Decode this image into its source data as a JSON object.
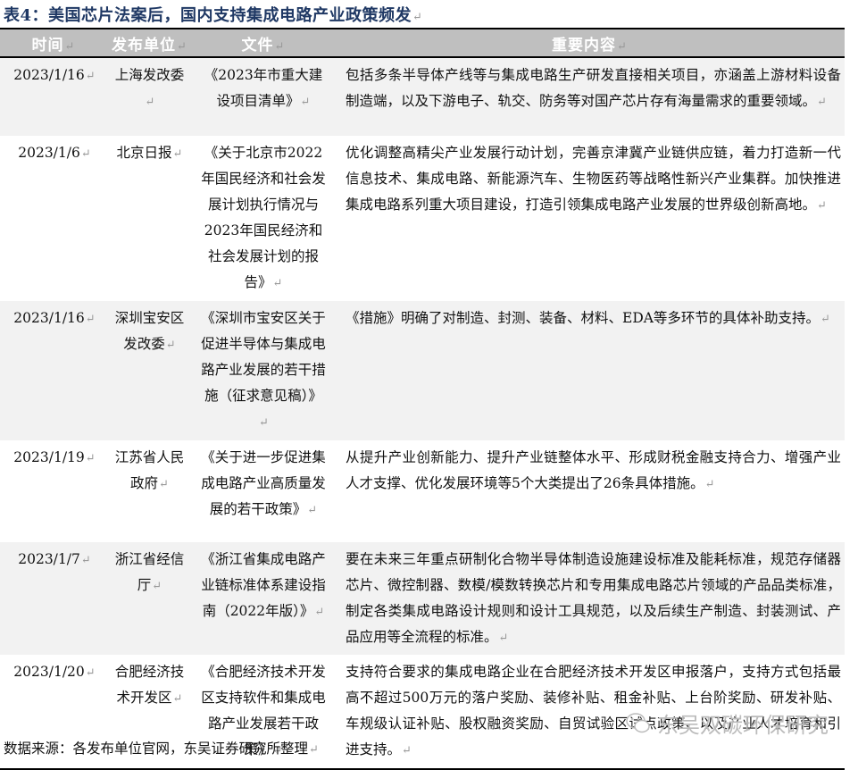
{
  "title": "表4：美国芯片法案后，国内支持集成电路产业政策频发",
  "headers": [
    "时间",
    "发布单位",
    "文件",
    "重要内容"
  ],
  "rows": [
    {
      "time": "2023/1/16",
      "unit": "上海发改委",
      "doc": "《2023年市重大建设项目清单》",
      "content": "包括多条半导体产线等与集成电路生产研发直接相关项目，亦涵盖上游材料设备制造端，以及下游电子、轨交、防务等对国产芯片存有海量需求的重要领域。"
    },
    {
      "time": "2023/1/6",
      "unit": "北京日报",
      "doc": "《关于北京市2022年国民经济和社会发展计划执行情况与2023年国民经济和社会发展计划的报告》",
      "content": "优化调整高精尖产业发展行动计划，完善京津冀产业链供应链，着力打造新一代信息技术、集成电路、新能源汽车、生物医药等战略性新兴产业集群。加快推进集成电路系列重大项目建设，打造引领集成电路产业发展的世界级创新高地。"
    },
    {
      "time": "2023/1/16",
      "unit": "深圳宝安区发改委",
      "doc": "《深圳市宝安区关于促进半导体与集成电路产业发展的若干措施（征求意见稿）》",
      "content": "《措施》明确了对制造、封测、装备、材料、EDA等多环节的具体补助支持。"
    },
    {
      "time": "2023/1/19",
      "unit": "江苏省人民政府",
      "doc": "《关于进一步促进集成电路产业高质量发展的若干政策》",
      "content": "从提升产业创新能力、提升产业链整体水平、形成财税金融支持合力、增强产业人才支撑、优化发展环境等5个大类提出了26条具体措施。"
    },
    {
      "time": "2023/1/7",
      "unit": "浙江省经信厅",
      "doc": "《浙江省集成电路产业链标准体系建设指南（2022年版）》",
      "content": "要在未来三年重点研制化合物半导体制造设施建设标准及能耗标准，规范存储器芯片、微控制器、数模/模数转换芯片和专用集成电路芯片领域的产品品类标准，制定各类集成电路设计规则和设计工具规范，以及后续生产制造、封装测试、产品应用等全流程的标准。"
    },
    {
      "time": "2023/1/20",
      "unit": "合肥经济技术开发区",
      "doc": "《合肥经济技术开发区支持软件和集成电路产业发展若干政策》",
      "content": "支持符合要求的集成电路企业在合肥经济技术开发区申报落户，支持方式包括最高不超过500万元的落户奖励、装修补贴、租金补贴、上台阶奖励、研发补贴、车规级认证补贴、股权融资奖励、自贸试验区试点政策、以及产业人才培育和引进支持。"
    }
  ],
  "footer": "数据来源：各发布单位官网，东吴证券研究所整理",
  "watermark": "东吴双碳环保研究"
}
